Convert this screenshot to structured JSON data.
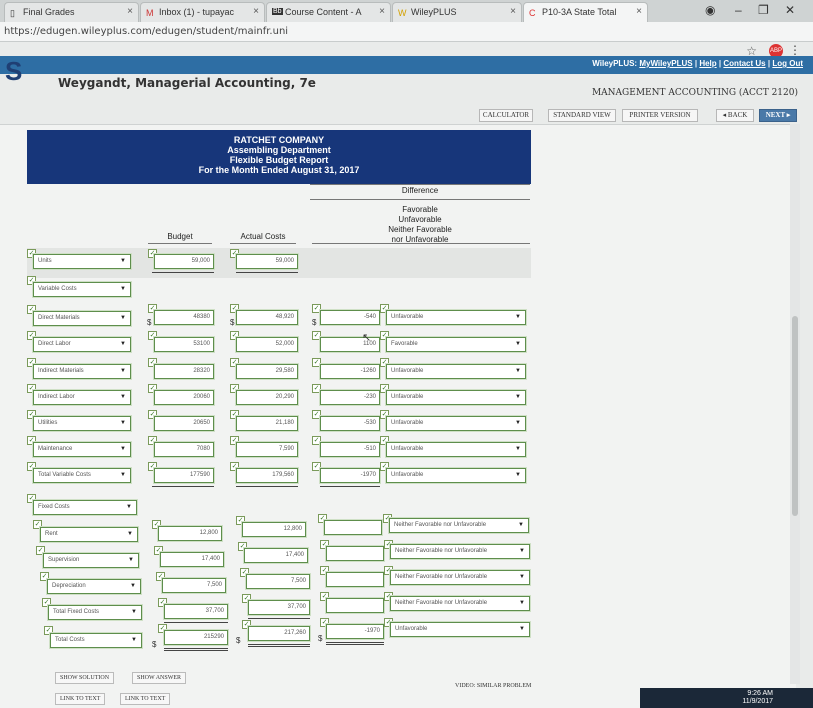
{
  "browser": {
    "tabs": [
      {
        "title": "Final Grades"
      },
      {
        "title": "Inbox (1) - tupayac"
      },
      {
        "title": "Course Content - A"
      },
      {
        "title": "WileyPLUS"
      },
      {
        "title": "P10-3A State Total"
      }
    ],
    "url": "https://edugen.wileyplus.com/edugen/student/mainfr.uni"
  },
  "wiley": {
    "logo": "S",
    "links": {
      "brand": "WileyPLUS:",
      "my": "MyWileyPLUS",
      "help": "Help",
      "contact": "Contact Us",
      "logout": "Log Out",
      "sep": "|"
    },
    "book_title": "Weygandt, Managerial Accounting, 7e",
    "course": "MANAGEMENT ACCOUNTING (ACCT 2120)",
    "buttons": {
      "calculator": "CALCULATOR",
      "standard": "STANDARD VIEW",
      "printer": "PRINTER VERSION",
      "back": "◂ BACK",
      "next": "NEXT ▸"
    }
  },
  "report": {
    "company": "RATCHET COMPANY",
    "dept": "Assembling Department",
    "name": "Flexible Budget Report",
    "period": "For the Month Ended August 31, 2017",
    "diff_header": "Difference",
    "diff_sub": [
      "Favorable",
      "Unfavorable",
      "Neither Favorable",
      "nor Unfavorable"
    ],
    "col_budget": "Budget",
    "col_actual": "Actual Costs"
  },
  "rows": {
    "units": {
      "label": "Units",
      "budget": "59,000",
      "actual": "59,000"
    },
    "var_header": {
      "label": "Variable Costs"
    },
    "dm": {
      "label": "Direct Materials",
      "dollar": "$",
      "budget": "48380",
      "actual": "48,920",
      "diff": "-540",
      "status": "Unfavorable"
    },
    "dl": {
      "label": "Direct Labor",
      "budget": "53100",
      "actual": "52,000",
      "diff": "1100",
      "status": "Favorable"
    },
    "im": {
      "label": "Indirect Materials",
      "budget": "28320",
      "actual": "29,580",
      "diff": "-1260",
      "status": "Unfavorable"
    },
    "il": {
      "label": "Indirect Labor",
      "budget": "20060",
      "actual": "20,290",
      "diff": "-230",
      "status": "Unfavorable"
    },
    "ut": {
      "label": "Utilities",
      "budget": "20650",
      "actual": "21,180",
      "diff": "-530",
      "status": "Unfavorable"
    },
    "mt": {
      "label": "Maintenance",
      "budget": "7080",
      "actual": "7,590",
      "diff": "-510",
      "status": "Unfavorable"
    },
    "tvc": {
      "label": "Total Variable Costs",
      "budget": "177590",
      "actual": "179,560",
      "diff": "-1970",
      "status": "Unfavorable"
    },
    "fixed_header": {
      "label": "Fixed Costs"
    },
    "rent": {
      "label": "Rent",
      "budget": "12,800",
      "actual": "12,800",
      "diff": "",
      "status": "Neither Favorable nor Unfavorable"
    },
    "sup": {
      "label": "Supervision",
      "budget": "17,400",
      "actual": "17,400",
      "diff": "",
      "status": "Neither Favorable nor Unfavorable"
    },
    "dep": {
      "label": "Depreciation",
      "budget": "7,500",
      "actual": "7,500",
      "diff": "",
      "status": "Neither Favorable nor Unfavorable"
    },
    "tfc": {
      "label": "Total Fixed Costs",
      "budget": "37,700",
      "actual": "37,700",
      "diff": "",
      "status": "Neither Favorable nor Unfavorable"
    },
    "tc": {
      "label": "Total Costs",
      "budget": "215290",
      "actual": "217,260",
      "diff": "-1970",
      "status": "Unfavorable"
    }
  },
  "footer": {
    "show_solution": "SHOW SOLUTION",
    "show_answer": "SHOW ANSWER",
    "link_text1": "LINK TO TEXT",
    "link_text2": "LINK TO TEXT",
    "video": "VIDEO: SIMILAR PROBLEM",
    "time": "9:26 AM",
    "date": "11/9/2017"
  }
}
